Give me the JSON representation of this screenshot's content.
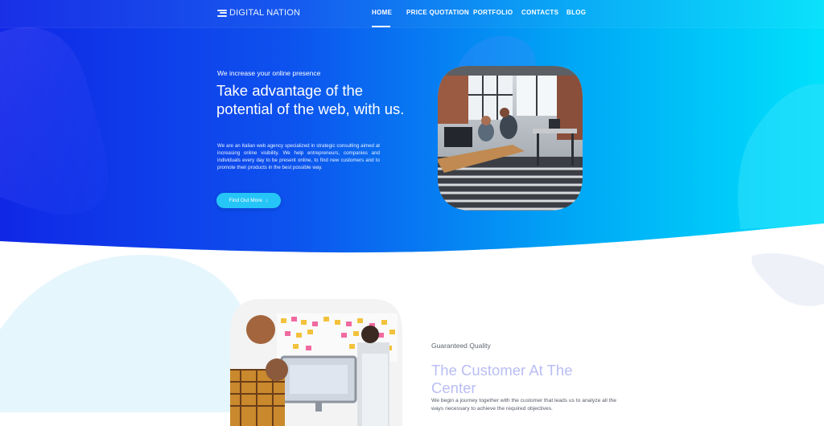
{
  "brand": {
    "name": "DIGITAL NATION",
    "icon": "menu-lines-icon"
  },
  "nav": {
    "items": [
      {
        "label": "HOME",
        "active": true
      },
      {
        "label": "PRICE QUOTATION",
        "active": false
      },
      {
        "label": "PORTFOLIO",
        "active": false
      },
      {
        "label": "CONTACTS",
        "active": false
      },
      {
        "label": "BLOG",
        "active": false
      }
    ]
  },
  "hero": {
    "eyebrow": "We increase your online presence",
    "headline": "Take advantage of the potential of the web, with us.",
    "body": "We are an Italian web agency specialized in strategic consulting aimed at increasing online visibility. We help entrepreneurs, companies and individuals every day to be present online, to find new customers and to promote their products in the best possible way.",
    "cta": {
      "label": "Find Out More",
      "icon": "arrow-down-icon"
    },
    "image": "open-plan office with people working at computers"
  },
  "section2": {
    "eyebrow": "Guaranteed Quality",
    "headline": "The Customer At The Center",
    "body": "We begin a journey together with the customer that leads us to analyze all the ways necessary to achieve the required objectives.",
    "image": "team meeting in front of a sticky-note board and monitor"
  },
  "colors": {
    "gradient_start": "#1027e6",
    "gradient_end": "#00e1fb",
    "cta": "#25c6f7",
    "headline2": "#b9bdf3"
  }
}
